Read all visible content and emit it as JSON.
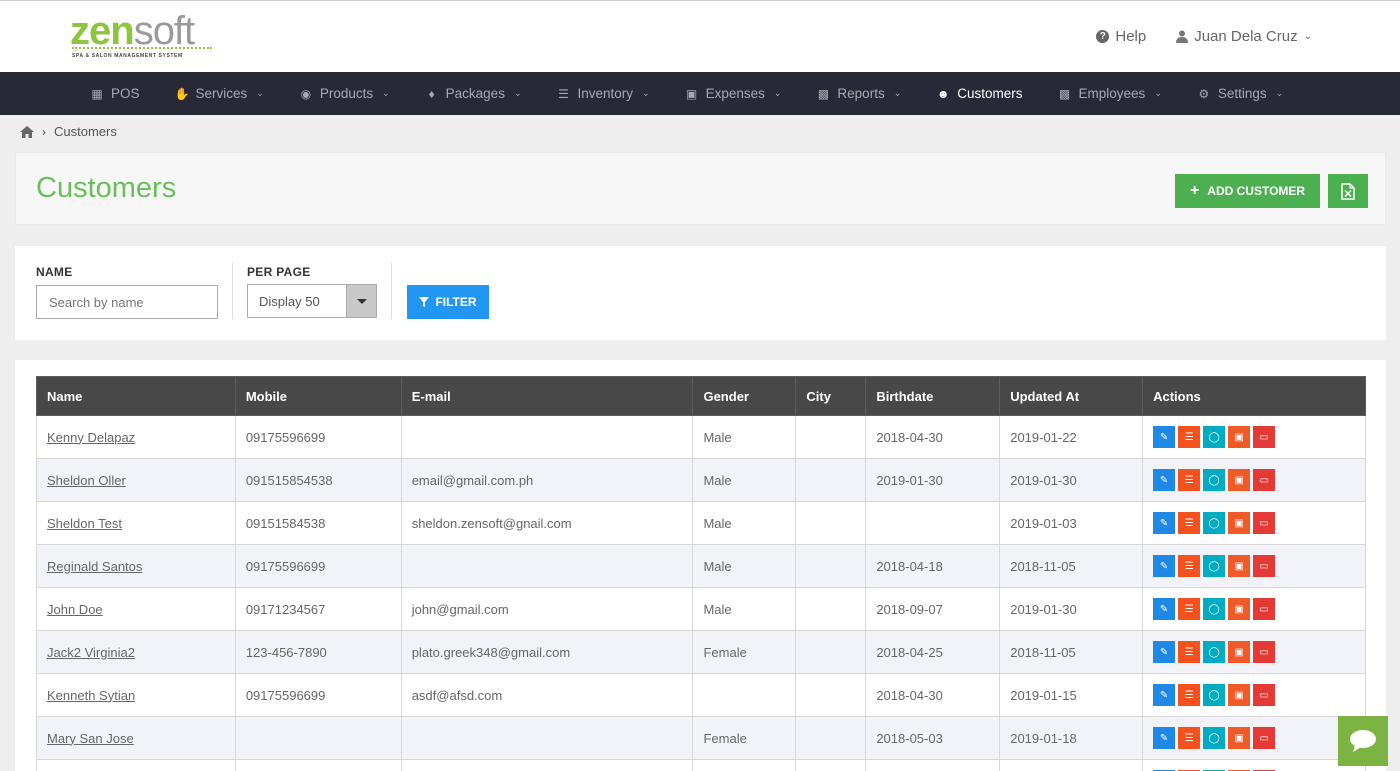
{
  "brand": {
    "zen": "zen",
    "soft": "soft",
    "tagline": "SPA & SALON MANAGEMENT SYSTEM",
    "color": "#8cc63f"
  },
  "header": {
    "help_label": "Help",
    "user_name": "Juan Dela Cruz"
  },
  "nav": {
    "items": [
      {
        "label": "POS",
        "icon": "calculator-icon",
        "caret": false,
        "active": false
      },
      {
        "label": "Services",
        "icon": "hand-icon",
        "caret": true,
        "active": false
      },
      {
        "label": "Products",
        "icon": "cart-icon",
        "caret": true,
        "active": false
      },
      {
        "label": "Packages",
        "icon": "tags-icon",
        "caret": true,
        "active": false
      },
      {
        "label": "Inventory",
        "icon": "list-icon",
        "caret": true,
        "active": false
      },
      {
        "label": "Expenses",
        "icon": "image-icon",
        "caret": true,
        "active": false
      },
      {
        "label": "Reports",
        "icon": "bar-chart-icon",
        "caret": true,
        "active": false
      },
      {
        "label": "Customers",
        "icon": "users-icon",
        "caret": false,
        "active": true
      },
      {
        "label": "Employees",
        "icon": "briefcase-icon",
        "caret": true,
        "active": false
      },
      {
        "label": "Settings",
        "icon": "gear-icon",
        "caret": true,
        "active": false
      }
    ]
  },
  "breadcrumb": {
    "current": "Customers"
  },
  "page": {
    "title": "Customers",
    "add_label": "ADD CUSTOMER",
    "accent": "#6abf5a"
  },
  "filter": {
    "name_label": "NAME",
    "name_placeholder": "Search by name",
    "per_page_label": "PER PAGE",
    "per_page_value": "Display 50",
    "filter_label": "FILTER"
  },
  "table": {
    "headers": [
      "Name",
      "Mobile",
      "E-mail",
      "Gender",
      "City",
      "Birthdate",
      "Updated At",
      "Actions"
    ],
    "rows": [
      {
        "name": "Kenny Delapaz",
        "mobile": "09175596699",
        "email": "",
        "gender": "Male",
        "city": "",
        "birthdate": "2018-04-30",
        "updated": "2019-01-22"
      },
      {
        "name": "Sheldon Oller",
        "mobile": "091515854538",
        "email": "email@gmail.com.ph",
        "gender": "Male",
        "city": "",
        "birthdate": "2019-01-30",
        "updated": "2019-01-30"
      },
      {
        "name": "Sheldon Test",
        "mobile": "09151584538",
        "email": "sheldon.zensoft@gnail.com",
        "gender": "Male",
        "city": "",
        "birthdate": "",
        "updated": "2019-01-03"
      },
      {
        "name": "Reginald Santos",
        "mobile": "09175596699",
        "email": "",
        "gender": "Male",
        "city": "",
        "birthdate": "2018-04-18",
        "updated": "2018-11-05"
      },
      {
        "name": "John Doe",
        "mobile": "09171234567",
        "email": "john@gmail.com",
        "gender": "Male",
        "city": "",
        "birthdate": "2018-09-07",
        "updated": "2019-01-30"
      },
      {
        "name": "Jack2 Virginia2",
        "mobile": "123-456-7890",
        "email": "plato.greek348@gmail.com",
        "gender": "Female",
        "city": "",
        "birthdate": "2018-04-25",
        "updated": "2018-11-05"
      },
      {
        "name": "Kenneth Sytian",
        "mobile": "09175596699",
        "email": "asdf@afsd.com",
        "gender": "",
        "city": "",
        "birthdate": "2018-04-30",
        "updated": "2019-01-15"
      },
      {
        "name": "Mary San Jose",
        "mobile": "",
        "email": "",
        "gender": "Female",
        "city": "",
        "birthdate": "2018-05-03",
        "updated": "2019-01-18"
      },
      {
        "name": "",
        "mobile": "",
        "email": "",
        "gender": "",
        "city": "",
        "birthdate": "",
        "updated": ""
      }
    ]
  }
}
